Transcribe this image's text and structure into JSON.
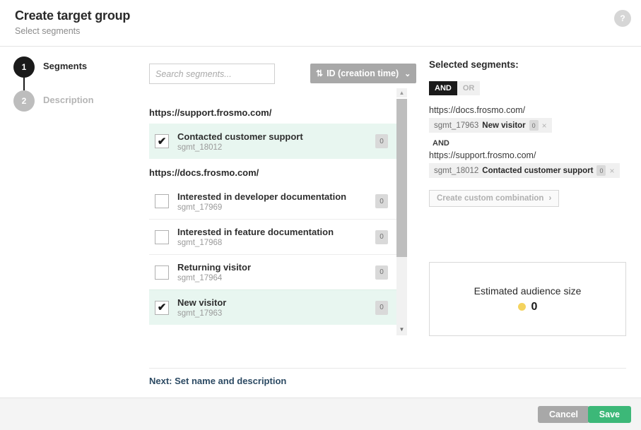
{
  "header": {
    "title": "Create target group",
    "subtitle": "Select segments",
    "help_icon_label": "?"
  },
  "steps": [
    {
      "number": "1",
      "label": "Segments",
      "state": "active"
    },
    {
      "number": "2",
      "label": "Description",
      "state": "inactive"
    }
  ],
  "search": {
    "placeholder": "Search segments...",
    "value": ""
  },
  "sort": {
    "label": "ID (creation time)",
    "arrows_glyph": "⇅",
    "caret_glyph": "⌄"
  },
  "segment_list": {
    "groups": [
      {
        "url": "https://support.frosmo.com/",
        "segments": [
          {
            "name": "Contacted customer support",
            "id": "sgmt_18012",
            "count": "0",
            "selected": true
          }
        ]
      },
      {
        "url": "https://docs.frosmo.com/",
        "segments": [
          {
            "name": "Interested in developer documentation",
            "id": "sgmt_17969",
            "count": "0",
            "selected": false
          },
          {
            "name": "Interested in feature documentation",
            "id": "sgmt_17968",
            "count": "0",
            "selected": false
          },
          {
            "name": "Returning visitor",
            "id": "sgmt_17964",
            "count": "0",
            "selected": false
          },
          {
            "name": "New visitor",
            "id": "sgmt_17963",
            "count": "0",
            "selected": true
          }
        ]
      }
    ],
    "checked_glyph": "✔",
    "scroll_up_glyph": "▲",
    "scroll_down_glyph": "▼"
  },
  "selected_panel": {
    "title": "Selected segments:",
    "operator_options": [
      {
        "label": "AND",
        "active": true
      },
      {
        "label": "OR",
        "active": false
      }
    ],
    "entries": [
      {
        "conjunction": "",
        "url": "https://docs.frosmo.com/",
        "chip_id": "sgmt_17963",
        "chip_name": "New visitor",
        "chip_count": "0",
        "remove_glyph": "×"
      },
      {
        "conjunction": "AND",
        "url": "https://support.frosmo.com/",
        "chip_id": "sgmt_18012",
        "chip_name": "Contacted customer support",
        "chip_count": "0",
        "remove_glyph": "×"
      }
    ],
    "custom_combination_label": "Create custom combination",
    "custom_combination_caret": "›"
  },
  "audience": {
    "label": "Estimated audience size",
    "value": "0",
    "dot_color": "#f4d35e"
  },
  "next": {
    "label": "Next: Set name and description"
  },
  "footer": {
    "cancel_label": "Cancel",
    "save_label": "Save"
  },
  "colors": {
    "selected_row": "#e8f6f0",
    "save_green": "#3cb878",
    "cancel_gray": "#a8a8a8",
    "step_active": "#1a1a1a",
    "step_inactive": "#bdbdbd"
  }
}
